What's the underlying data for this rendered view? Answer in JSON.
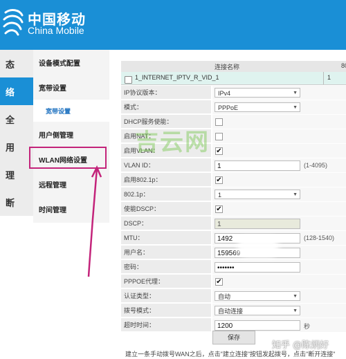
{
  "brand": {
    "name_cn": "中国移动",
    "name_en": "China Mobile",
    "color": "#1a8fd6"
  },
  "left_nav": [
    {
      "label": "态",
      "active": false
    },
    {
      "label": "络",
      "active": true
    },
    {
      "label": "全",
      "active": false
    },
    {
      "label": "用",
      "active": false
    },
    {
      "label": "理",
      "active": false
    },
    {
      "label": "断",
      "active": false
    }
  ],
  "sub_nav": {
    "items": [
      "设备模式配置",
      "宽带设置",
      "用户侧管理",
      "WLAN网络设置",
      "远程管理",
      "时间管理"
    ],
    "sub_item": "宽带设置"
  },
  "grid": {
    "col_name": "连接名称",
    "col_2": "80",
    "row_name": "1_INTERNET_IPTV_R_VID_1",
    "row_col2": "1"
  },
  "form": [
    {
      "label": "IP协议版本：",
      "type": "select",
      "value": "IPv4"
    },
    {
      "label": "模式：",
      "type": "select",
      "value": "PPPoE"
    },
    {
      "label": "DHCP服务使能：",
      "type": "checkbox",
      "checked": false
    },
    {
      "label": "启用NAT：",
      "type": "checkbox",
      "checked": false
    },
    {
      "label": "启用VLAN：",
      "type": "checkbox",
      "checked": true
    },
    {
      "label": "VLAN ID：",
      "type": "text",
      "value": "1",
      "hint": "(1-4095)"
    },
    {
      "label": "启用802.1p：",
      "type": "checkbox",
      "checked": true
    },
    {
      "label": "802.1p：",
      "type": "select",
      "value": "1"
    },
    {
      "label": "使能DSCP：",
      "type": "checkbox",
      "checked": true
    },
    {
      "label": "DSCP：",
      "type": "text-disabled",
      "value": "1"
    },
    {
      "label": "MTU：",
      "type": "text",
      "value": "1492",
      "hint": "(128-1540)"
    },
    {
      "label": "用户名：",
      "type": "text",
      "value": "159569"
    },
    {
      "label": "密码：",
      "type": "text",
      "value": "•••••••"
    },
    {
      "label": "PPPOE代理：",
      "type": "checkbox",
      "checked": true
    },
    {
      "label": "认证类型：",
      "type": "select",
      "value": "自动"
    },
    {
      "label": "拨号模式：",
      "type": "select",
      "value": "自动连接"
    },
    {
      "label": "超时时间：",
      "type": "text",
      "value": "1200",
      "hint": "秒"
    }
  ],
  "save_label": "保存",
  "footnote": "建立一条手动拨号WAN之后，点击\"建立连接\"按钮发起拨号，点击\"断开连接\"",
  "watermarks": {
    "center": "吉云网",
    "corner": "知乎 @陈炳好"
  },
  "annotation_color": "#c3237a"
}
